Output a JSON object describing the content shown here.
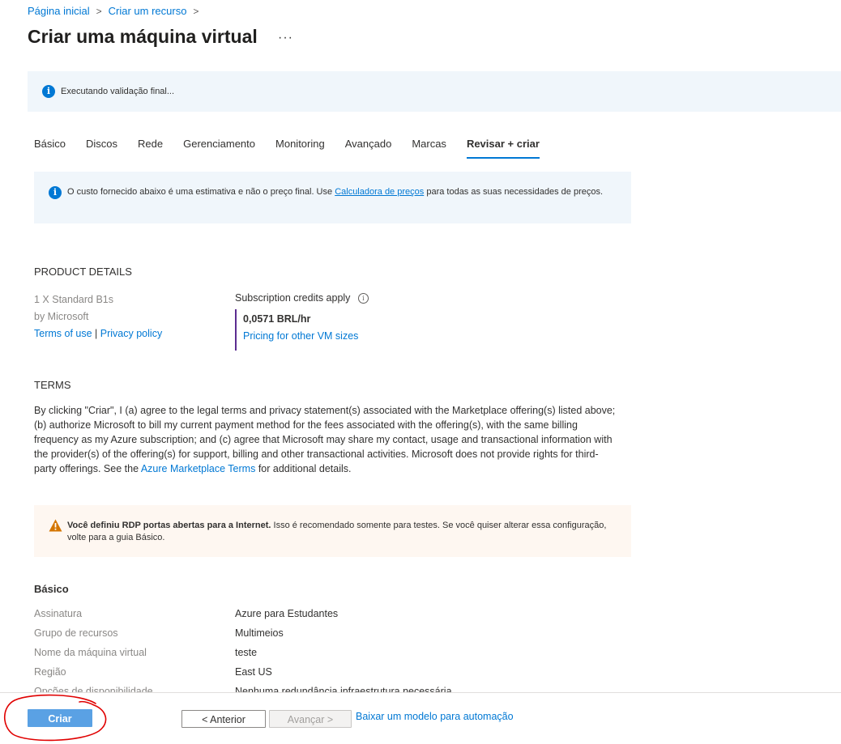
{
  "breadcrumb": {
    "home": "Página inicial",
    "create_resource": "Criar um recurso",
    "separator": ">"
  },
  "page": {
    "title": "Criar uma máquina virtual",
    "more": "···"
  },
  "validation_banner": {
    "text": "Executando validação final..."
  },
  "tabs": [
    {
      "label": "Básico",
      "active": false
    },
    {
      "label": "Discos",
      "active": false
    },
    {
      "label": "Rede",
      "active": false
    },
    {
      "label": "Gerenciamento",
      "active": false
    },
    {
      "label": "Monitoring",
      "active": false
    },
    {
      "label": "Avançado",
      "active": false
    },
    {
      "label": "Marcas",
      "active": false
    },
    {
      "label": "Revisar + criar",
      "active": true
    }
  ],
  "cost_info": {
    "before_link": "O custo fornecido abaixo é uma estimativa e não o preço final. Use",
    "link": "Calculadora de preços",
    "after_link": "para todas as suas necessidades de preços."
  },
  "product_details": {
    "heading": "PRODUCT DETAILS",
    "product": "1 X Standard B1s",
    "publisher": "by Microsoft",
    "terms_link": "Terms of use",
    "sep": "|",
    "privacy_link": "Privacy policy",
    "credits": "Subscription credits apply",
    "price": "0,0571 BRL/hr",
    "pricing_link": "Pricing for other VM sizes"
  },
  "terms": {
    "heading": "TERMS",
    "text_before": "By clicking \"Criar\", I (a) agree to the legal terms and privacy statement(s) associated with the Marketplace offering(s) listed above; (b) authorize Microsoft to bill my current payment method for the fees associated with the offering(s), with the same billing frequency as my Azure subscription; and (c) agree that Microsoft may share my contact, usage and transactional information with the provider(s) of the offering(s) for support, billing and other transactional activities. Microsoft does not provide rights for third-party offerings. See the",
    "link": "Azure Marketplace Terms",
    "text_after": "for additional details."
  },
  "rdp_warning": {
    "bold": "Você definiu RDP portas abertas para a Internet.",
    "text": "Isso é recomendado somente para testes.  Se você quiser alterar essa configuração, volte para a guia Básico."
  },
  "basic_summary": {
    "heading": "Básico",
    "rows": [
      {
        "label": "Assinatura",
        "value": "Azure para Estudantes"
      },
      {
        "label": "Grupo de recursos",
        "value": "Multimeios"
      },
      {
        "label": "Nome da máquina virtual",
        "value": "teste"
      },
      {
        "label": "Região",
        "value": "East US"
      },
      {
        "label": "Opções de disponibilidade",
        "value": "Nenhuma redundância infraestrutura necessária"
      }
    ]
  },
  "footer": {
    "create": "Criar",
    "previous": "< Anterior",
    "next": "Avançar >",
    "download_template": "Baixar um modelo para automação"
  },
  "colors": {
    "accent": "#0078d4",
    "banner_bg": "#f0f6fb",
    "warning_bg": "#fef7f1",
    "warning_icon": "#d47500",
    "annotation": "#e00000"
  }
}
